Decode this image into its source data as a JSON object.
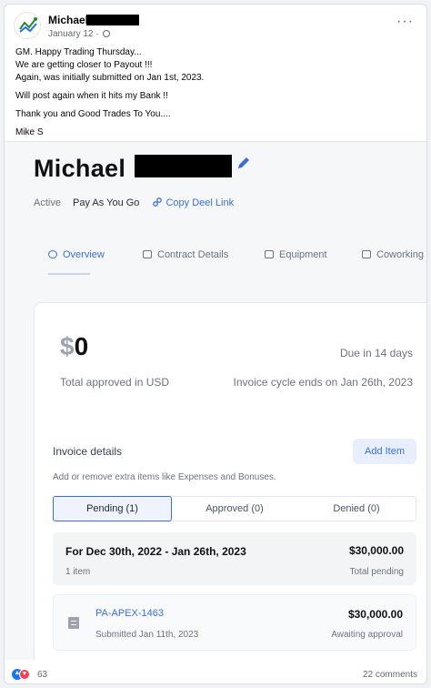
{
  "post": {
    "author": "Michael",
    "date": "January 12",
    "lines": [
      "GM.  Happy Trading Thursday...",
      "We are getting closer to Payout !!!",
      "Again, was initially submitted on Jan 1st, 2023.",
      "Will post again when it hits my Bank !!",
      "Thank you and Good Trades To You....",
      "Mike S"
    ]
  },
  "profile": {
    "name": "Michael",
    "status": "Active",
    "plan": "Pay As You Go",
    "copy_link": "Copy Deel Link"
  },
  "tabs": [
    {
      "label": "Overview",
      "icon": "overview-icon"
    },
    {
      "label": "Contract Details",
      "icon": "contract-icon"
    },
    {
      "label": "Equipment",
      "icon": "laptop-icon"
    },
    {
      "label": "Coworking",
      "icon": "building-icon"
    }
  ],
  "summary": {
    "currency_symbol": "$",
    "amount": "0",
    "total_label": "Total approved in USD",
    "due": "Due in 14 days",
    "cycle": "Invoice cycle ends on Jan 26th, 2023"
  },
  "invoice": {
    "title": "Invoice details",
    "add_label": "Add Item",
    "subtitle": "Add or remove extra items like Expenses and Bonuses.",
    "segments": [
      "Pending (1)",
      "Approved (0)",
      "Denied (0)"
    ],
    "period": {
      "title": "For Dec 30th, 2022 - Jan 26th, 2023",
      "amount": "$30,000.00",
      "count": "1 item",
      "status": "Total pending"
    },
    "row": {
      "id": "PA-APEX-1463",
      "amount": "$30,000.00",
      "submitted": "Submitted Jan 11th, 2023",
      "status": "Awaiting approval"
    }
  },
  "footer": {
    "reactions": "63",
    "comments": "22 comments"
  },
  "colors": {
    "accent": "#3b6fd8",
    "like": "#1877f2",
    "love": "#f33e58"
  }
}
